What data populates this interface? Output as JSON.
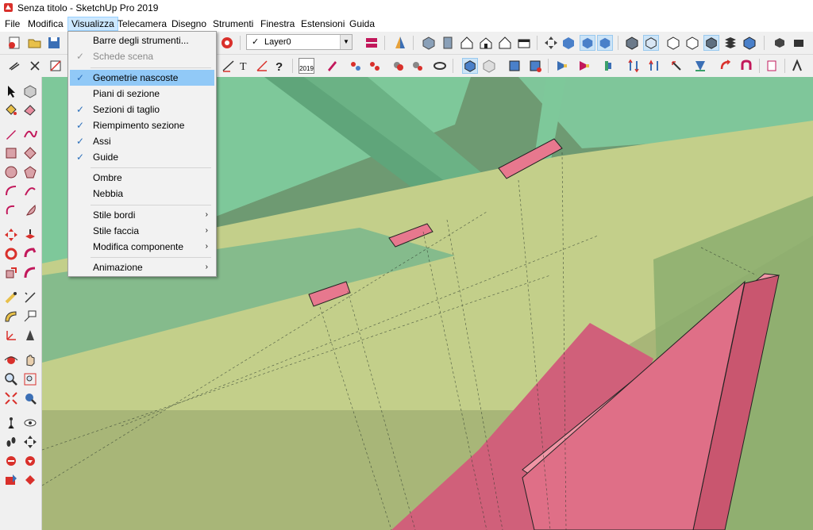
{
  "window": {
    "title": "Senza titolo - SketchUp Pro 2019"
  },
  "menubar": {
    "items": [
      "File",
      "Modifica",
      "Visualizza",
      "Telecamera",
      "Disegno",
      "Strumenti",
      "Finestra",
      "Estensioni",
      "Guida"
    ],
    "active": "Visualizza"
  },
  "layer_select": {
    "value": "Layer0",
    "checked": "✓"
  },
  "toolbar_text": {
    "calendar": "2019"
  },
  "view_menu": {
    "items": [
      {
        "label": "Barre degli strumenti...",
        "checked": false,
        "submenu": false,
        "disabled": false,
        "highlight": false
      },
      {
        "label": "Schede scena",
        "checked": true,
        "submenu": false,
        "disabled": true,
        "highlight": false
      },
      {
        "label": "Geometrie nascoste",
        "checked": true,
        "submenu": false,
        "disabled": false,
        "highlight": true
      },
      {
        "label": "Piani di sezione",
        "checked": false,
        "submenu": false,
        "disabled": false,
        "highlight": false
      },
      {
        "label": "Sezioni di taglio",
        "checked": true,
        "submenu": false,
        "disabled": false,
        "highlight": false
      },
      {
        "label": "Riempimento sezione",
        "checked": true,
        "submenu": false,
        "disabled": false,
        "highlight": false
      },
      {
        "label": "Assi",
        "checked": true,
        "submenu": false,
        "disabled": false,
        "highlight": false
      },
      {
        "label": "Guide",
        "checked": true,
        "submenu": false,
        "disabled": false,
        "highlight": false
      },
      {
        "label": "Ombre",
        "checked": false,
        "submenu": false,
        "disabled": false,
        "highlight": false
      },
      {
        "label": "Nebbia",
        "checked": false,
        "submenu": false,
        "disabled": false,
        "highlight": false
      },
      {
        "label": "Stile bordi",
        "checked": false,
        "submenu": true,
        "disabled": false,
        "highlight": false
      },
      {
        "label": "Stile faccia",
        "checked": false,
        "submenu": true,
        "disabled": false,
        "highlight": false
      },
      {
        "label": "Modifica componente",
        "checked": false,
        "submenu": true,
        "disabled": false,
        "highlight": false
      },
      {
        "label": "Animazione",
        "checked": false,
        "submenu": true,
        "disabled": false,
        "highlight": false
      }
    ],
    "check_glyph": "✓",
    "arrow_glyph": "›"
  },
  "colors": {
    "menu_highlight": "#91c9f7",
    "model_green": "#7ec89a",
    "model_olive": "#c3cf8a",
    "model_pink": "#e7788e",
    "background": "#6e9a72"
  }
}
